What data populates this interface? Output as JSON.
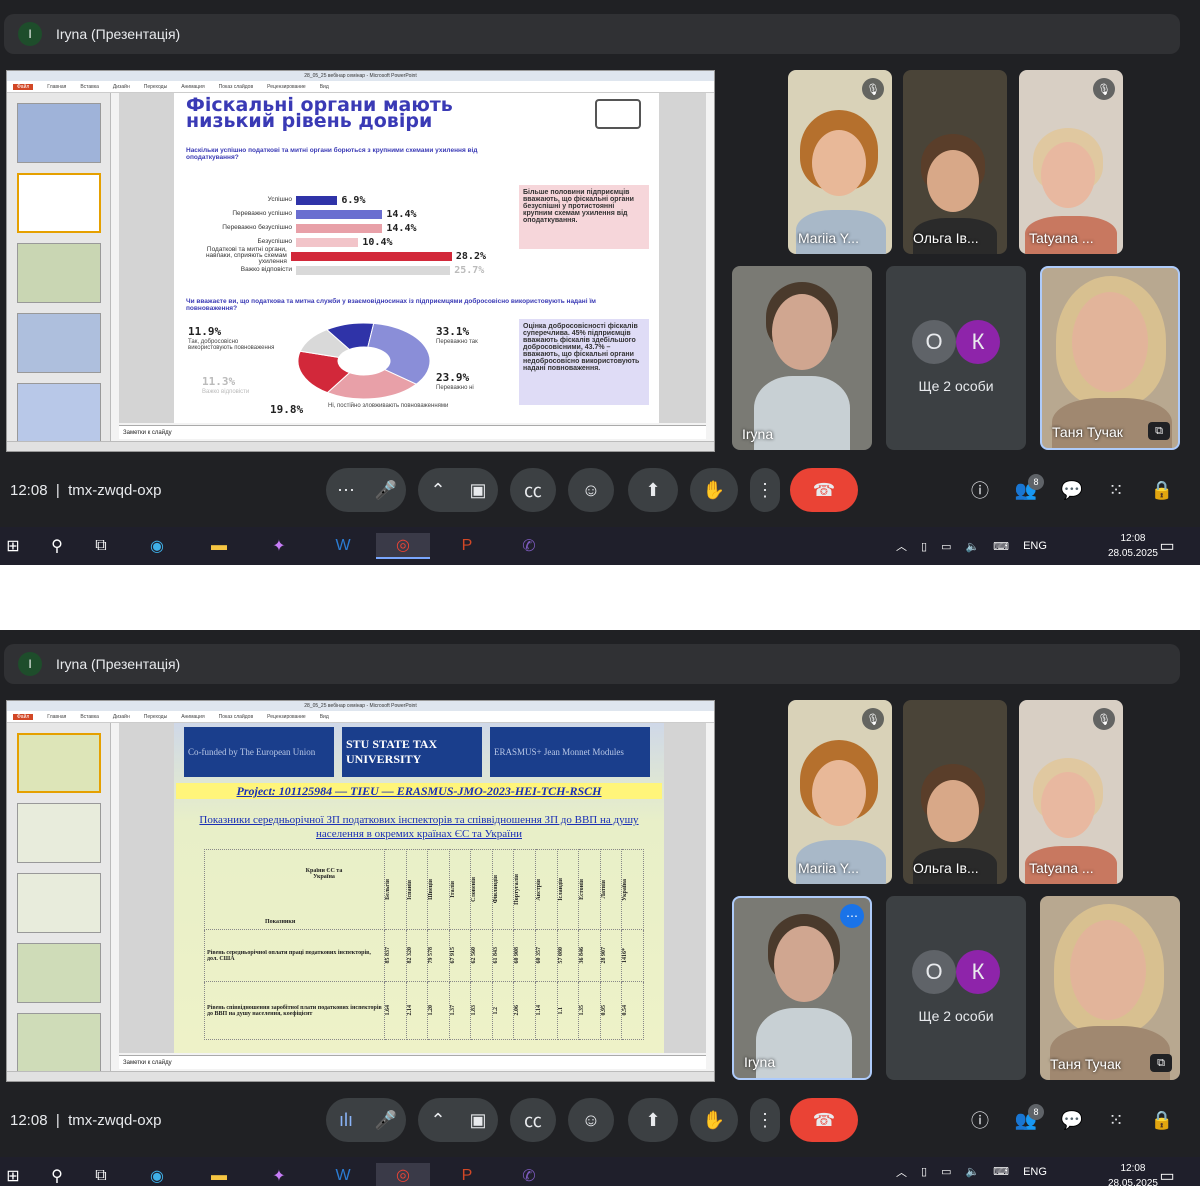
{
  "presentation_bar": {
    "avatar_letter": "I",
    "title": "Iryna (Презентація)"
  },
  "meeting": {
    "time": "12:08",
    "code": "tmx-zwqd-oxp",
    "participants_badge": "8"
  },
  "participants": {
    "mariia": "Mariia Y...",
    "olga": "Ольга Ів...",
    "tatyana": "Tatyana ...",
    "iryna": "Iryna",
    "others_label": "Ще 2 особи",
    "others_letters": [
      "О",
      "К"
    ],
    "tanya": "Таня Тучак"
  },
  "ppt": {
    "notes_placeholder": "Заметки к слайду",
    "window_title_1": "28_05_25 вебінар семінар - Microsoft PowerPoint",
    "window_title_2": "28_05_25 вебінар семінар - Microsoft PowerPoint"
  },
  "slide1": {
    "title": "Фіскальні органи мають низький рівень довіри",
    "question1": "Наскільки успішно податкові та митні органи борються з крупними схемами ухилення від оподаткування?",
    "chart_data": {
      "type": "bar",
      "categories": [
        "Успішно",
        "Переважно успішно",
        "Переважно безуспішно",
        "Безуспішно",
        "Податкові та митні органи, навпаки, сприяють схемам ухилення",
        "Важко відповісти"
      ],
      "values": [
        6.9,
        14.4,
        14.4,
        10.4,
        28.2,
        25.7
      ],
      "value_labels": [
        "6.9%",
        "14.4%",
        "14.4%",
        "10.4%",
        "28.2%",
        "25.7%"
      ],
      "colors": [
        "#2f33a8",
        "#6a6ed0",
        "#e8a0a8",
        "#f2c4c9",
        "#d2283a",
        "#d9d9d9"
      ]
    },
    "callout1": "Більше половини підприємців вважають, що фіскальні органи безуспішні у протистоянні крупним схемам ухилення від оподаткування.",
    "question2": "Чи вважаєте ви, що податкова та митна служби у взаємовідносинах із підприємцями добросовісно використовують надані їм повноваження?",
    "donut": {
      "segments": [
        {
          "label": "Так, добросовісно використовують повноваження",
          "value_label": "11.9%",
          "value": 11.9,
          "color": "#2f33a8"
        },
        {
          "label": "Переважно так",
          "value_label": "33.1%",
          "value": 33.1,
          "color": "#8a8ed8"
        },
        {
          "label": "Переважно ні",
          "value_label": "23.9%",
          "value": 23.9,
          "color": "#e8a0a8"
        },
        {
          "label": "Ні, постійно зловживають повноваженнями",
          "value_label": "19.8%",
          "value": 19.8,
          "color": "#d2283a"
        },
        {
          "label": "Важко відповісти",
          "value_label": "11.3%",
          "value": 11.3,
          "color": "#d9d9d9"
        }
      ]
    },
    "callout2": "Оцінка добросовісності фіскалів суперечлива. 45% підприємців вважають фіскалів здебільшого добросовісними, 43.7% – вважають, що фіскальні органи недобросовісно використовують надані повноваження."
  },
  "slide2": {
    "logo1": "Co-funded by The European Union",
    "logo2": "STU STATE TAX UNIVERSITY",
    "logo3": "ERASMUS+ Jean Monnet Modules",
    "project": "Project: 101125984 — TIEU — ERASMUS-JMO-2023-HEI-TCH-RSCH",
    "table_title": "Показники середньорічної ЗП податкових інспекторів та співвідношення ЗП до ВВП на душу населення в окремих країнах ЄС та України",
    "corner_top": "Країни ЄС та Україна",
    "corner_bottom": "Показники",
    "countries": [
      "Бельгія",
      "Іспанія",
      "Швеція",
      "Італія",
      "Словенія",
      "Фінляндія",
      "Португалія",
      "Австрія",
      "Ісландія",
      "Естонія",
      "Латвія",
      "Україна"
    ],
    "row1_label": "Рівень середньорічної оплати праці податкових інспекторів, дол. США",
    "row1": [
      "85 837",
      "82 320",
      "79 578",
      "67 915",
      "62 560",
      "61 843",
      "60 908",
      "60 357",
      "57 080",
      "36 846",
      "28 907",
      "1416*"
    ],
    "row2_label": "Рівень співвідношення заробітної плати податкових інспекторів до ВВП на душу населення, коефіцієнт",
    "row2": [
      "1.64",
      "2.14",
      "1.20",
      "1.37",
      "1.83",
      "1.2",
      "2.06",
      "1.14",
      "1.1",
      "1.35",
      "0.95",
      "0.54"
    ]
  },
  "taskbar": {
    "lang": "ENG",
    "time": "12:08",
    "date": "28.05.2025"
  }
}
